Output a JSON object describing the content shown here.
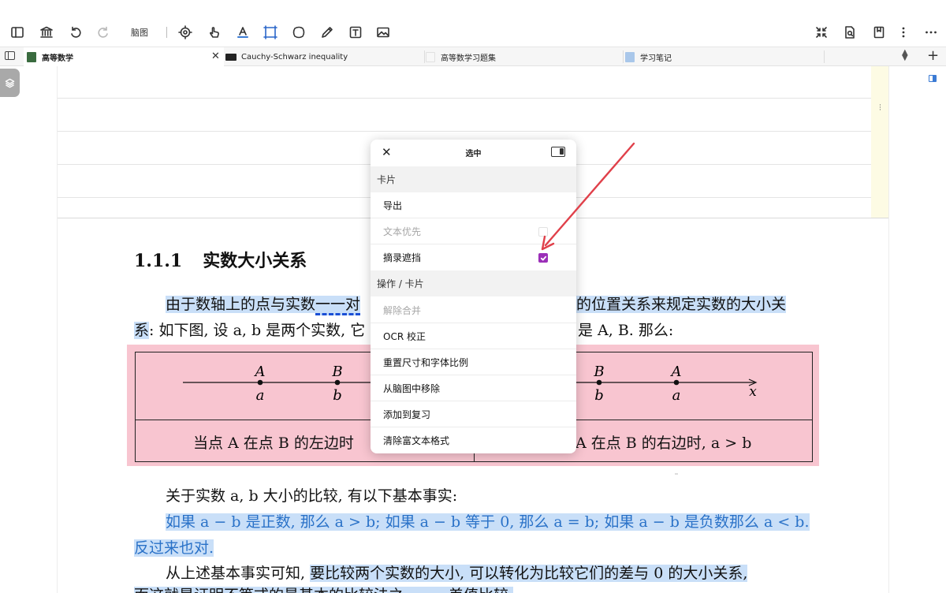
{
  "toolbar": {
    "mindmap_label": "脑图"
  },
  "tabs": [
    {
      "label": "高等数学",
      "active": true,
      "icon_color": "#3a6b3f"
    },
    {
      "label": "Cauchy-Schwarz inequality",
      "active": false,
      "icon_color": "#222222"
    },
    {
      "label": "高等数学习题集",
      "active": false,
      "icon_color": "#f4f4f4"
    },
    {
      "label": "学习笔记",
      "active": false,
      "icon_color": "#a9c7ea"
    }
  ],
  "document": {
    "heading_number": "1.1.1",
    "heading_text": "实数大小关系",
    "para1_line1_a": "由于数轴上的点与实数",
    "para1_line1_b": "一一对",
    "para1_line1_c": "的位置关系来规定实数的大小关",
    "para1_line2_a": "系",
    "para1_line2_b": ": 如下图, 设 a, b 是两个实数, 它",
    "para1_line2_c": "是 A, B. 那么:",
    "fig_left_caption": "当点 A 在点 B 的左边时",
    "fig_right_caption": "A 在点 B 的右边时, a > b",
    "para2": "关于实数 a, b 大小的比较, 有以下基本事实:",
    "para3_line1": "如果 a − b 是正数, 那么 a > b; 如果 a − b 等于 0, 那么 a = b; 如果 a − b 是负数那么 a < b.",
    "para3_line2": "反过来也对.",
    "para4_a": "从上述基本事实可知,",
    "para4_b": "要比较两个实数的大小, 可以转化为比较它们的差与 0 的大小关系,",
    "para5": "而这就是证明不等式的最基本的比较法之一——差值比较."
  },
  "figure": {
    "left_points": [
      {
        "upper": "A",
        "lower": "a"
      },
      {
        "upper": "B",
        "lower": "b"
      }
    ],
    "right_points": [
      {
        "upper": "B",
        "lower": "b"
      },
      {
        "upper": "A",
        "lower": "a"
      }
    ],
    "axis_label": "x"
  },
  "popup": {
    "title": "选中",
    "section_card": "卡片",
    "item_export": "导出",
    "item_text_first": "文本优先",
    "item_excerpt_mask": "摘录遮挡",
    "excerpt_mask_checked": true,
    "section_actions": "操作 / 卡片",
    "item_unmerge": "解除合并",
    "item_ocr": "OCR 校正",
    "item_reset_size": "重置尺寸和字体比例",
    "item_remove_mindmap": "从脑图中移除",
    "item_add_review": "添加到复习",
    "item_clear_format": "清除富文本格式",
    "checkbox_color": "#9b2fb8"
  },
  "colors": {
    "highlight": "#c9dff8",
    "pink_box": "#f8c5d0",
    "blue_text": "#2a72c8",
    "arrow": "#e0404a"
  }
}
